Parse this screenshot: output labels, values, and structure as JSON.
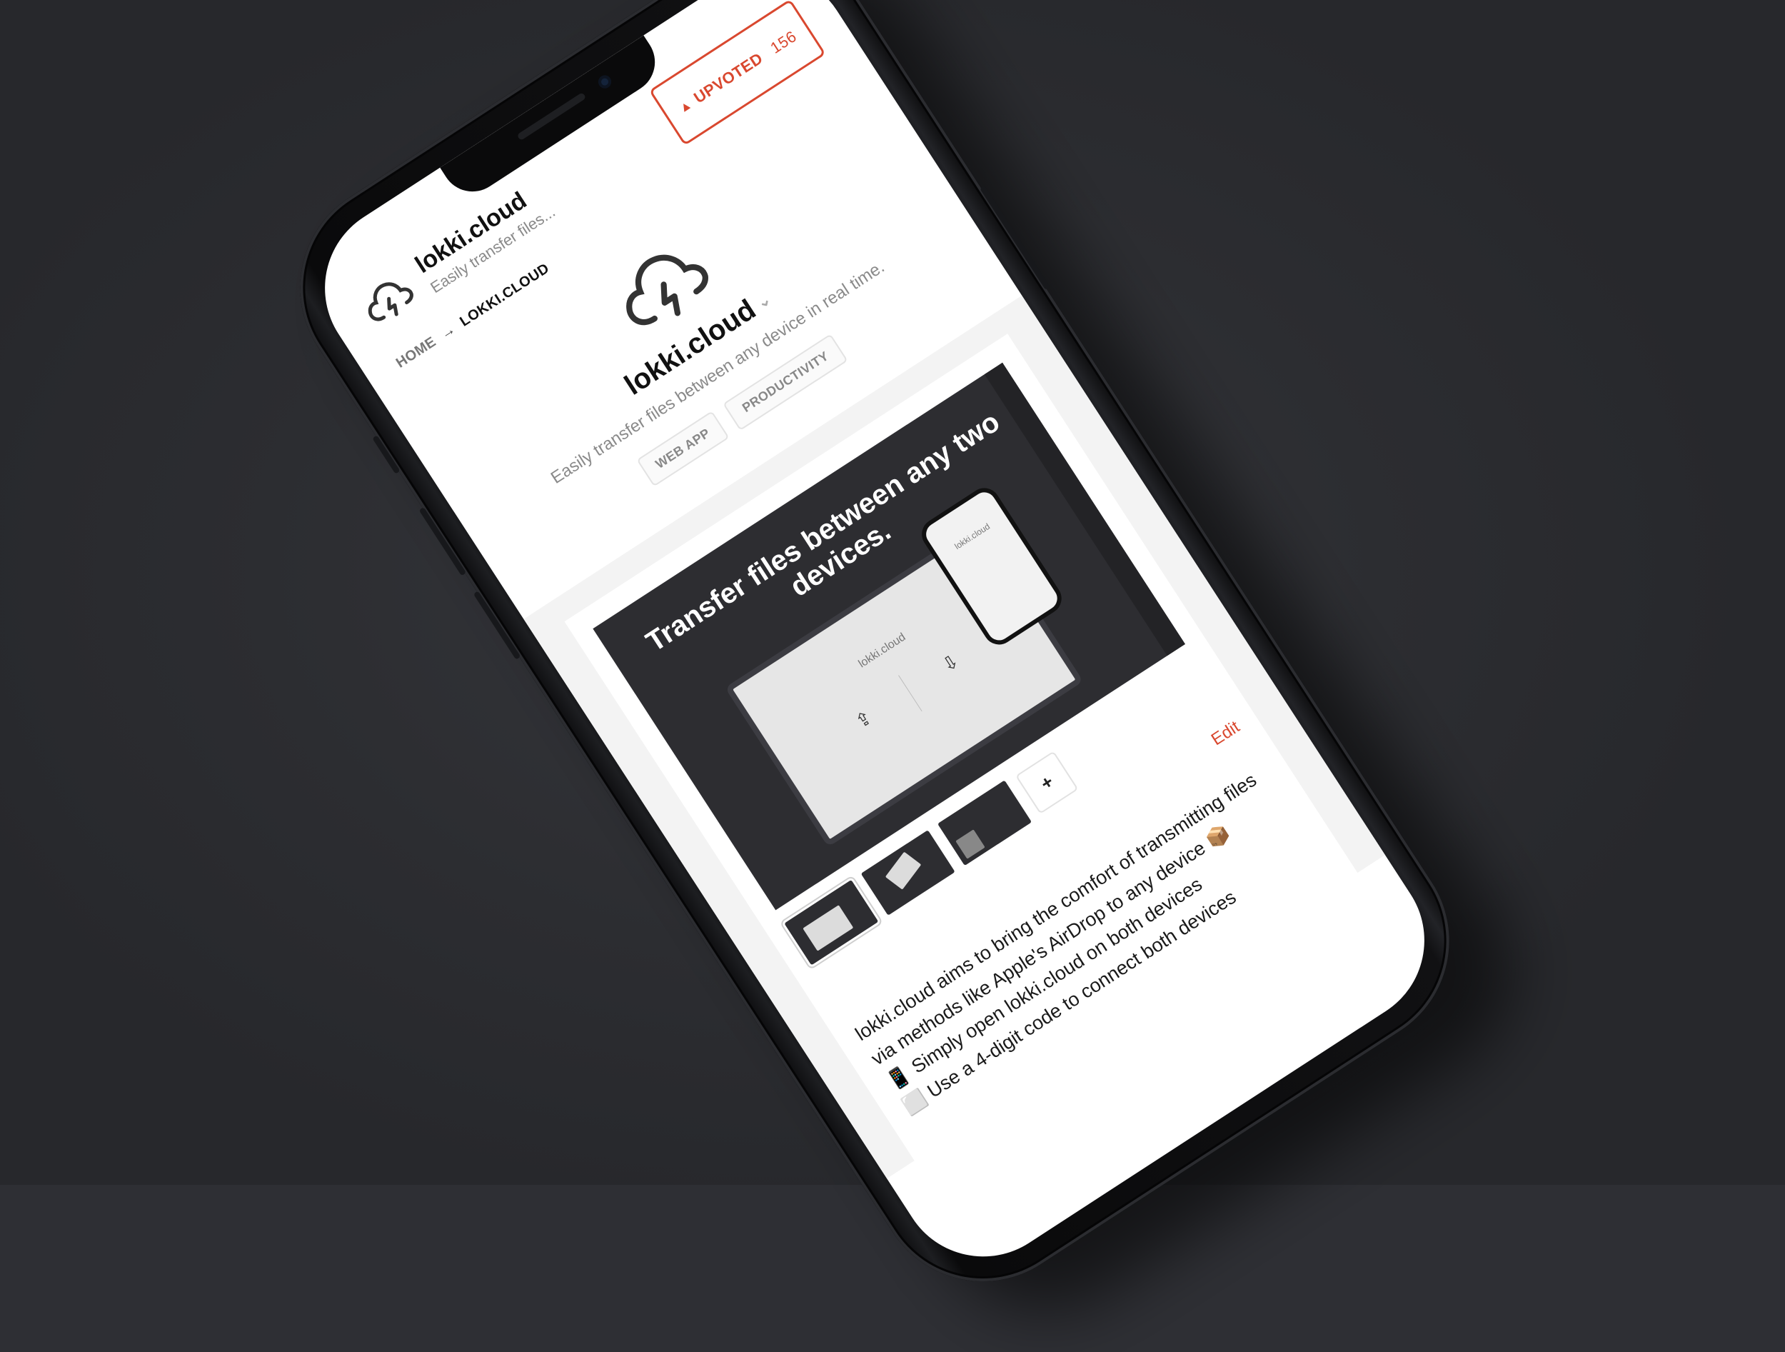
{
  "app": {
    "name": "lokki.cloud",
    "tagline_short": "Easily transfer files...",
    "tagline_full": "Easily transfer files between any device in real time."
  },
  "upvote": {
    "label": "UPVOTED",
    "count": "156",
    "icon": "triangle-up-icon"
  },
  "breadcrumb": {
    "home": "HOME",
    "separator": "→",
    "current": "LOKKI.CLOUD"
  },
  "tags": [
    "WEB APP",
    "PRODUCTIVITY"
  ],
  "gallery": {
    "headline": "Transfer files between any two devices.",
    "laptop_title": "lokki.cloud",
    "phone_title": "lokki.cloud",
    "add_label": "+"
  },
  "edit_label": "Edit",
  "description": [
    "lokki.cloud aims to bring the comfort of transmitting files via methods like Apple's AirDrop to any device 📦",
    "📱 Simply open lokki.cloud on both devices",
    "⬜ Use a 4-digit code to connect both devices"
  ],
  "colors": {
    "accent": "#d9482f",
    "background": "#2e2f34",
    "screen": "#ffffff"
  }
}
